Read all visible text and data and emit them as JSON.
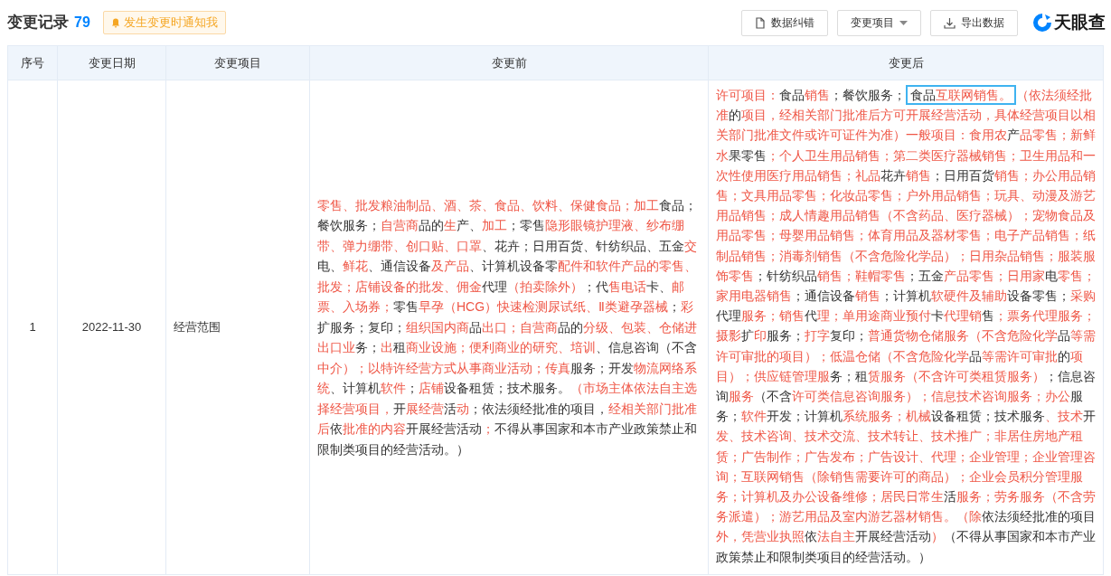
{
  "header": {
    "title": "变更记录",
    "count": "79",
    "notify_button": "发生变更时通知我",
    "actions": [
      {
        "label": "数据纠错",
        "kind": "file"
      },
      {
        "label": "变更项目",
        "kind": "dropdown"
      },
      {
        "label": "导出数据",
        "kind": "export"
      }
    ],
    "logo": "天眼查"
  },
  "table": {
    "columns": [
      "序号",
      "变更日期",
      "变更项目",
      "变更前",
      "变更后"
    ],
    "rows": [
      {
        "index": "1",
        "date": "2022-11-30",
        "item": "经营范围",
        "before": [
          {
            "text": "零售、批发粮油制品、酒、茶、食品、饮料、保健食品；加工",
            "changed": true
          },
          {
            "text": "食品；餐饮服务；",
            "changed": false
          },
          {
            "text": "自营商",
            "changed": true
          },
          {
            "text": "品的",
            "changed": false
          },
          {
            "text": "生",
            "changed": true
          },
          {
            "text": "产、",
            "changed": false
          },
          {
            "text": "加工",
            "changed": true
          },
          {
            "text": "；零售",
            "changed": false
          },
          {
            "text": "隐形眼镜护理液、纱布绷带、弹力绷带、创口贴、口罩",
            "changed": true
          },
          {
            "text": "、花卉；日用百货、针纺织品、五金",
            "changed": false
          },
          {
            "text": "交",
            "changed": true
          },
          {
            "text": "电、",
            "changed": false
          },
          {
            "text": "鲜花",
            "changed": true
          },
          {
            "text": "、通信设备",
            "changed": false
          },
          {
            "text": "及产品",
            "changed": true
          },
          {
            "text": "、计算机设备零",
            "changed": false
          },
          {
            "text": "配件和软件产品的零售、批发；店铺设备的批发、佣金",
            "changed": true
          },
          {
            "text": "代理",
            "changed": false
          },
          {
            "text": "（拍卖除外）",
            "changed": true
          },
          {
            "text": "；代",
            "changed": false
          },
          {
            "text": "售电话",
            "changed": true
          },
          {
            "text": "卡、",
            "changed": false
          },
          {
            "text": "邮票、入场券；",
            "changed": true
          },
          {
            "text": "零售",
            "changed": false
          },
          {
            "text": "早孕（HCG）快速检测尿试纸、Ⅱ类避孕器械",
            "changed": true
          },
          {
            "text": "；",
            "changed": false
          },
          {
            "text": "彩",
            "changed": true
          },
          {
            "text": "扩服务；复印；",
            "changed": false
          },
          {
            "text": "组织国内商",
            "changed": true
          },
          {
            "text": "品",
            "changed": false
          },
          {
            "text": "出口；自营商",
            "changed": true
          },
          {
            "text": "品的",
            "changed": false
          },
          {
            "text": "分级、包装、仓储进出口业",
            "changed": true
          },
          {
            "text": "务；",
            "changed": false
          },
          {
            "text": "出",
            "changed": true
          },
          {
            "text": "租",
            "changed": false
          },
          {
            "text": "商业设施；便利商业的研究、培训",
            "changed": true
          },
          {
            "text": "、信息咨询（不含",
            "changed": false
          },
          {
            "text": "中介）；以特许经营方式从事商业活动；传真",
            "changed": true
          },
          {
            "text": "服务；开发",
            "changed": false
          },
          {
            "text": "物流网络系统",
            "changed": true
          },
          {
            "text": "、计算机",
            "changed": false
          },
          {
            "text": "软件",
            "changed": true
          },
          {
            "text": "；",
            "changed": false
          },
          {
            "text": "店铺",
            "changed": true
          },
          {
            "text": "设备租赁；技术服务。",
            "changed": false
          },
          {
            "text": "（市场主体依法自主选择经营项目，",
            "changed": true
          },
          {
            "text": "开",
            "changed": false
          },
          {
            "text": "展经营",
            "changed": true
          },
          {
            "text": "活",
            "changed": false
          },
          {
            "text": "动",
            "changed": true
          },
          {
            "text": "；依法须经批准的项目，",
            "changed": false
          },
          {
            "text": "经相关部门批准后",
            "changed": true
          },
          {
            "text": "依",
            "changed": false
          },
          {
            "text": "批准的内容",
            "changed": true
          },
          {
            "text": "开展经营活动",
            "changed": false
          },
          {
            "text": "；",
            "changed": true
          },
          {
            "text": "不得从事国家和本市产业政策禁止和限制类项目的经营活动。）",
            "changed": false
          }
        ],
        "after": [
          {
            "text": "许可项目：",
            "changed": true
          },
          {
            "text": "食品",
            "changed": false
          },
          {
            "text": "销售",
            "changed": true
          },
          {
            "text": "；餐饮服务；",
            "changed": false
          },
          {
            "kind": "boxed",
            "parts": [
              {
                "text": "食品",
                "changed": false
              },
              {
                "text": "互联网销售。",
                "changed": true
              }
            ]
          },
          {
            "text": "（依法须经批准",
            "changed": true
          },
          {
            "text": "的",
            "changed": false
          },
          {
            "text": "项目，经相关部门批准后方可开展经营活动，具体经营项目以相关部门批准文件或许可证件为准）一般项目：食用农",
            "changed": true
          },
          {
            "text": "产",
            "changed": false
          },
          {
            "text": "品零售；新鲜水",
            "changed": true
          },
          {
            "text": "果零售",
            "changed": false
          },
          {
            "text": "；个人卫生用品销售；第二类医疗器械销售；卫生用品和一次性使用医疗用品销售；礼品",
            "changed": true
          },
          {
            "text": "花卉",
            "changed": false
          },
          {
            "text": "销售",
            "changed": true
          },
          {
            "text": "；日用百货",
            "changed": false
          },
          {
            "text": "销售；办公用品销售；文具用品零售；化妆品零售；户外用品销售；玩具、动漫及游艺用品销售；成人情趣用品销售（不含药品、医疗器械）；宠物食品及用品零售；母婴用品销售；体育用品及器材零售；电子产品销售；纸制品销售；消毒剂销售（不含危险化学品）；日用杂品销售；服装服饰零售",
            "changed": true
          },
          {
            "text": "；针纺织品",
            "changed": false
          },
          {
            "text": "销售；鞋帽零售",
            "changed": true
          },
          {
            "text": "；五金",
            "changed": false
          },
          {
            "text": "产品零售；日用家",
            "changed": true
          },
          {
            "text": "电",
            "changed": false
          },
          {
            "text": "零售；家用电器销售",
            "changed": true
          },
          {
            "text": "；通信设备",
            "changed": false
          },
          {
            "text": "销售",
            "changed": true
          },
          {
            "text": "；计算机",
            "changed": false
          },
          {
            "text": "软硬件及辅助",
            "changed": true
          },
          {
            "text": "设备零售；",
            "changed": false
          },
          {
            "text": "采购",
            "changed": true
          },
          {
            "text": "代理",
            "changed": false
          },
          {
            "text": "服务；销售",
            "changed": true
          },
          {
            "text": "代",
            "changed": false
          },
          {
            "text": "理；单用途商业预付",
            "changed": true
          },
          {
            "text": "卡",
            "changed": false
          },
          {
            "text": "代理销",
            "changed": true
          },
          {
            "text": "售",
            "changed": false
          },
          {
            "text": "；票务代理服务；摄影",
            "changed": true
          },
          {
            "text": "扩",
            "changed": false
          },
          {
            "text": "印",
            "changed": true
          },
          {
            "text": "服务；",
            "changed": false
          },
          {
            "text": "打字",
            "changed": true
          },
          {
            "text": "复印；",
            "changed": false
          },
          {
            "text": "普通货物仓储服务（不含危险化学",
            "changed": true
          },
          {
            "text": "品",
            "changed": false
          },
          {
            "text": "等需许可审批的项目）；低温仓储（不含危险化学",
            "changed": true
          },
          {
            "text": "品",
            "changed": false
          },
          {
            "text": "等需许可审批",
            "changed": true
          },
          {
            "text": "的",
            "changed": false
          },
          {
            "text": "项目）；供应链管理服",
            "changed": true
          },
          {
            "text": "务；租",
            "changed": false
          },
          {
            "text": "赁服务（不含许可类租赁服务）",
            "changed": true
          },
          {
            "text": "；信息咨询",
            "changed": false
          },
          {
            "text": "服务",
            "changed": true
          },
          {
            "text": "（不含",
            "changed": false
          },
          {
            "text": "许可类信息咨询服务）；信息技术咨询服务；办公",
            "changed": true
          },
          {
            "text": "服务；",
            "changed": false
          },
          {
            "text": "软件",
            "changed": true
          },
          {
            "text": "开发；计算机",
            "changed": false
          },
          {
            "text": "系统服务；机械",
            "changed": true
          },
          {
            "text": "设备租赁；技术服务",
            "changed": false
          },
          {
            "text": "、技术",
            "changed": true
          },
          {
            "text": "开",
            "changed": false
          },
          {
            "text": "发、技术咨询、技术交流、技术转让、技术推广；非居住房地产租赁；广告制作；广告发布；广告设计、代理；企业管理；企业管理咨询；互联网销售（除销售需要许可的商品）；企业会员积分管理服务；计算机及办公设备维修；居民日常生",
            "changed": true
          },
          {
            "text": "活",
            "changed": false
          },
          {
            "text": "服务；劳务服务（不含劳务派遣）；游艺用品及室内游艺器材销售。（除",
            "changed": true
          },
          {
            "text": "依法须经批准的项目",
            "changed": false
          },
          {
            "text": "外，凭营业执照",
            "changed": true
          },
          {
            "text": "依",
            "changed": false
          },
          {
            "text": "法自主",
            "changed": true
          },
          {
            "text": "开展经营活动",
            "changed": false
          },
          {
            "text": "）",
            "changed": true
          },
          {
            "text": "（不得从事国家和本市产业政策禁止和限制类项目的经营活动。）",
            "changed": false
          }
        ]
      }
    ]
  }
}
